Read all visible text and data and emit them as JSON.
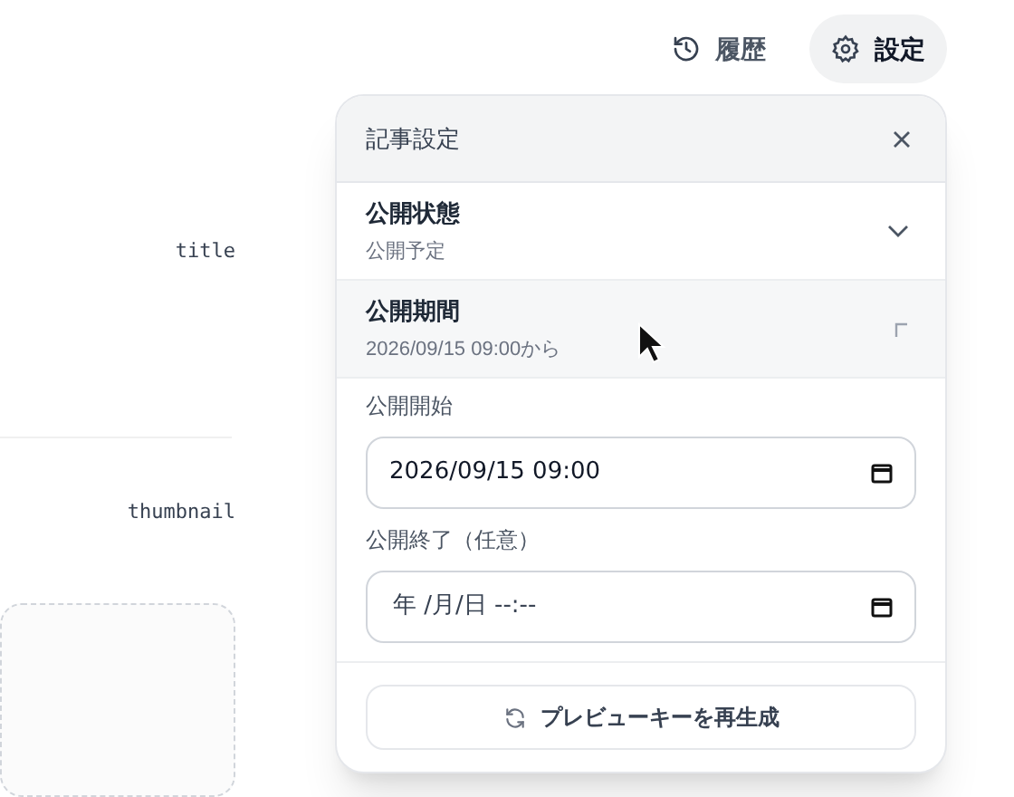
{
  "toolbar": {
    "buttons": [
      {
        "label": "履歴",
        "selected": false
      },
      {
        "label": "設定",
        "selected": true
      }
    ]
  },
  "form_labels": [
    {
      "label": "title"
    },
    {
      "label": "thumbnail"
    }
  ],
  "popover": {
    "title": "記事設定",
    "sections": [
      {
        "title": "公開状態",
        "summary": "公開予定",
        "expanded": false
      },
      {
        "title": "公開期間",
        "summary": "2026/09/15 09:00から",
        "expanded": true
      }
    ],
    "fields": [
      {
        "label": "公開開始",
        "value": "2026/09/15 09:00"
      },
      {
        "label": "公開終了（任意）",
        "placeholder": "年 /月/日 --:--"
      }
    ],
    "action": "プレビューキーを再生成"
  }
}
